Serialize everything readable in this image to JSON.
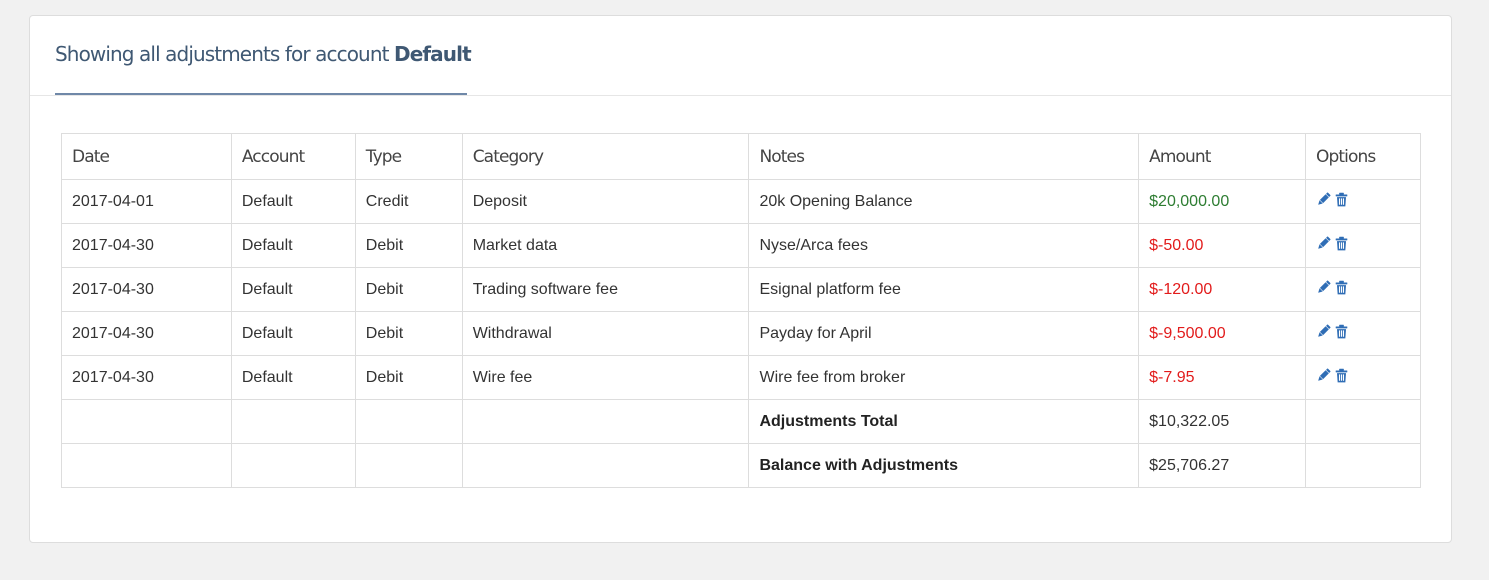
{
  "panel": {
    "title_prefix": "Showing all adjustments for account",
    "title_account": "Default"
  },
  "table": {
    "headers": [
      "Date",
      "Account",
      "Type",
      "Category",
      "Notes",
      "Amount",
      "Options"
    ],
    "rows": [
      {
        "date": "2017-04-01",
        "account": "Default",
        "type": "Credit",
        "category": "Deposit",
        "notes": "20k Opening Balance",
        "amount": "$20,000.00"
      },
      {
        "date": "2017-04-30",
        "account": "Default",
        "type": "Debit",
        "category": "Market data",
        "notes": "Nyse/Arca fees",
        "amount": "$-50.00"
      },
      {
        "date": "2017-04-30",
        "account": "Default",
        "type": "Debit",
        "category": "Trading software fee",
        "notes": "Esignal platform fee",
        "amount": "$-120.00"
      },
      {
        "date": "2017-04-30",
        "account": "Default",
        "type": "Debit",
        "category": "Withdrawal",
        "notes": "Payday for April",
        "amount": "$-9,500.00"
      },
      {
        "date": "2017-04-30",
        "account": "Default",
        "type": "Debit",
        "category": "Wire fee",
        "notes": "Wire fee from broker",
        "amount": "$-7.95"
      }
    ],
    "summary": [
      {
        "label": "Adjustments Total",
        "value": "$10,322.05"
      },
      {
        "label": "Balance with Adjustments",
        "value": "$25,706.27"
      }
    ]
  },
  "icons": {
    "edit": "pencil-icon",
    "delete": "trash-icon",
    "icon_color": "#2f6db5"
  },
  "colors": {
    "positive_amount": "#2e7d32",
    "negative_amount": "#e21b1b",
    "title": "#3f5873"
  }
}
